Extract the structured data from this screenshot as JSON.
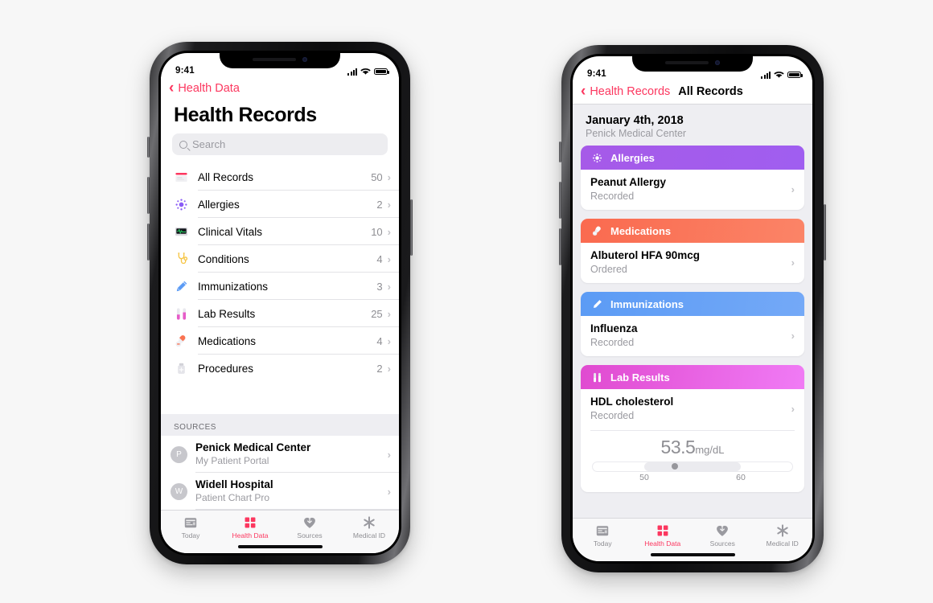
{
  "background_color": "#f7f7f7",
  "accent_color": "#fc375f",
  "phone_left": {
    "status_bar": {
      "time": "9:41",
      "signal_icon": "cellular-bars-icon",
      "wifi_icon": "wifi-icon",
      "battery_icon": "battery-full-icon"
    },
    "nav": {
      "back_label": "Health Data",
      "back_icon": "chevron-left-icon"
    },
    "title": "Health Records",
    "search": {
      "placeholder": "Search",
      "icon": "search-icon"
    },
    "records": [
      {
        "label": "All Records",
        "count": "50",
        "icon": "all-records-icon",
        "color": "#fc375f"
      },
      {
        "label": "Allergies",
        "count": "2",
        "icon": "allergies-icon",
        "color": "#8b5cf6"
      },
      {
        "label": "Clinical Vitals",
        "count": "10",
        "icon": "clinical-vitals-icon",
        "color": "#23d160"
      },
      {
        "label": "Conditions",
        "count": "4",
        "icon": "conditions-icon",
        "color": "#f6c544"
      },
      {
        "label": "Immunizations",
        "count": "3",
        "icon": "immunizations-icon",
        "color": "#5b9bf5"
      },
      {
        "label": "Lab Results",
        "count": "25",
        "icon": "lab-results-icon",
        "color": "#e65cc8"
      },
      {
        "label": "Medications",
        "count": "4",
        "icon": "medications-icon",
        "color": "#fa7352"
      },
      {
        "label": "Procedures",
        "count": "2",
        "icon": "procedures-icon",
        "color": "#b9b9bf"
      }
    ],
    "sources_header": "SOURCES",
    "sources": [
      {
        "initial": "P",
        "title": "Penick Medical Center",
        "subtitle": "My Patient Portal"
      },
      {
        "initial": "W",
        "title": "Widell Hospital",
        "subtitle": "Patient Chart Pro"
      }
    ],
    "tabs": [
      {
        "label": "Today",
        "icon": "today-calendar-icon",
        "active": false
      },
      {
        "label": "Health Data",
        "icon": "health-data-icon",
        "active": true
      },
      {
        "label": "Sources",
        "icon": "sources-heart-icon",
        "active": false
      },
      {
        "label": "Medical ID",
        "icon": "medical-id-icon",
        "active": false
      }
    ]
  },
  "phone_right": {
    "status_bar": {
      "time": "9:41",
      "signal_icon": "cellular-bars-icon",
      "wifi_icon": "wifi-icon",
      "battery_icon": "battery-full-icon"
    },
    "nav": {
      "back_label": "Health Records",
      "title": "All Records",
      "back_icon": "chevron-left-icon"
    },
    "date_header": {
      "date": "January 4th, 2018",
      "facility": "Penick Medical Center"
    },
    "cards": [
      {
        "category": "Allergies",
        "icon": "allergies-icon",
        "color_from": "#a65ae8",
        "color_to": "#a05ef0",
        "item_title": "Peanut Allergy",
        "item_status": "Recorded",
        "chevron": "chevron-right-icon"
      },
      {
        "category": "Medications",
        "icon": "medications-icon",
        "color_from": "#fa6a4f",
        "color_to": "#fb8467",
        "item_title": "Albuterol HFA 90mcg",
        "item_status": "Ordered",
        "chevron": "chevron-right-icon"
      },
      {
        "category": "Immunizations",
        "icon": "immunizations-icon",
        "color_from": "#5b9bf5",
        "color_to": "#74a9f7",
        "item_title": "Influenza",
        "item_status": "Recorded",
        "chevron": "chevron-right-icon"
      },
      {
        "category": "Lab Results",
        "icon": "lab-results-icon",
        "color_from": "#e04ad0",
        "color_to": "#f07bf5",
        "item_title": "HDL cholesterol",
        "item_status": "Recorded",
        "chevron": "chevron-right-icon",
        "measurement": {
          "value": "53.5",
          "unit": "mg/dL",
          "tick_low": "50",
          "tick_high": "60"
        }
      }
    ],
    "tabs": [
      {
        "label": "Today",
        "icon": "today-calendar-icon",
        "active": false
      },
      {
        "label": "Health Data",
        "icon": "health-data-icon",
        "active": true
      },
      {
        "label": "Sources",
        "icon": "sources-heart-icon",
        "active": false
      },
      {
        "label": "Medical ID",
        "icon": "medical-id-icon",
        "active": false
      }
    ]
  }
}
